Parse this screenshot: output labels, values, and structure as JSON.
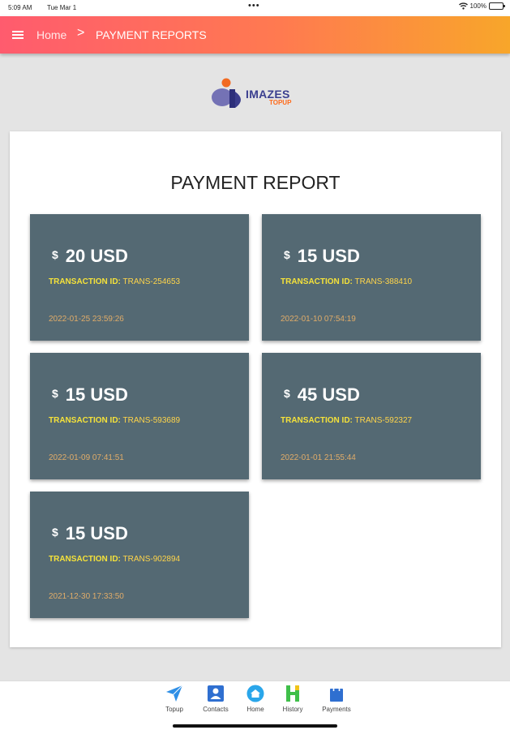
{
  "status_bar": {
    "time": "5:09 AM",
    "date": "Tue Mar 1",
    "battery": "100%",
    "battery_level": 1.0
  },
  "header": {
    "menu_icon": "hamburger-menu-icon",
    "breadcrumb_home": "Home",
    "breadcrumb_separator": ">",
    "breadcrumb_current": "PAYMENT REPORTS",
    "gradient": [
      "#ff5b6e",
      "#ff7a50",
      "#f8a62a"
    ]
  },
  "logo": {
    "word": "IMAZES",
    "sub": "TOPUP"
  },
  "report": {
    "title": "PAYMENT REPORT",
    "card_color": "#546973",
    "transaction_label": "TRANSACTION ID:",
    "cards": [
      {
        "currency": "$",
        "amount": "20 USD",
        "transaction_id": "TRANS-254653",
        "datetime": "2022-01-25 23:59:26"
      },
      {
        "currency": "$",
        "amount": "15 USD",
        "transaction_id": "TRANS-388410",
        "datetime": "2022-01-10 07:54:19"
      },
      {
        "currency": "$",
        "amount": "15 USD",
        "transaction_id": "TRANS-593689",
        "datetime": "2022-01-09 07:41:51"
      },
      {
        "currency": "$",
        "amount": "45 USD",
        "transaction_id": "TRANS-592327",
        "datetime": "2022-01-01 21:55:44"
      },
      {
        "currency": "$",
        "amount": "15 USD",
        "transaction_id": "TRANS-902894",
        "datetime": "2021-12-30 17:33:50"
      }
    ]
  },
  "bottom_nav": {
    "items": [
      {
        "label": "Topup",
        "icon": "paper-plane-icon"
      },
      {
        "label": "Contacts",
        "icon": "contacts-icon"
      },
      {
        "label": "Home",
        "icon": "home-icon"
      },
      {
        "label": "History",
        "icon": "history-icon"
      },
      {
        "label": "Payments",
        "icon": "shopping-bag-icon"
      }
    ]
  }
}
